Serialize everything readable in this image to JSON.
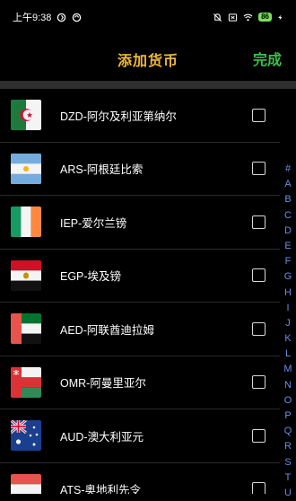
{
  "status_bar": {
    "time": "上午9:38",
    "battery": "86"
  },
  "header": {
    "title": "添加货币",
    "done_label": "完成"
  },
  "currencies": [
    {
      "label": "DZD-阿尔及利亚第纳尔",
      "flag": "algeria"
    },
    {
      "label": "ARS-阿根廷比索",
      "flag": "argentina"
    },
    {
      "label": "IEP-爱尔兰镑",
      "flag": "ireland"
    },
    {
      "label": "EGP-埃及镑",
      "flag": "egypt"
    },
    {
      "label": "AED-阿联酋迪拉姆",
      "flag": "uae"
    },
    {
      "label": "OMR-阿曼里亚尔",
      "flag": "oman"
    },
    {
      "label": "AUD-澳大利亚元",
      "flag": "australia"
    },
    {
      "label": "ATS-奥地利先令",
      "flag": "austria"
    }
  ],
  "index_letters": [
    "#",
    "A",
    "B",
    "C",
    "D",
    "E",
    "F",
    "G",
    "H",
    "I",
    "J",
    "K",
    "L",
    "M",
    "N",
    "O",
    "P",
    "Q",
    "R",
    "S",
    "T",
    "U"
  ],
  "colors": {
    "title": "#f0b640",
    "done": "#3fbf4a",
    "index": "#6a90e8",
    "background": "#000000"
  }
}
